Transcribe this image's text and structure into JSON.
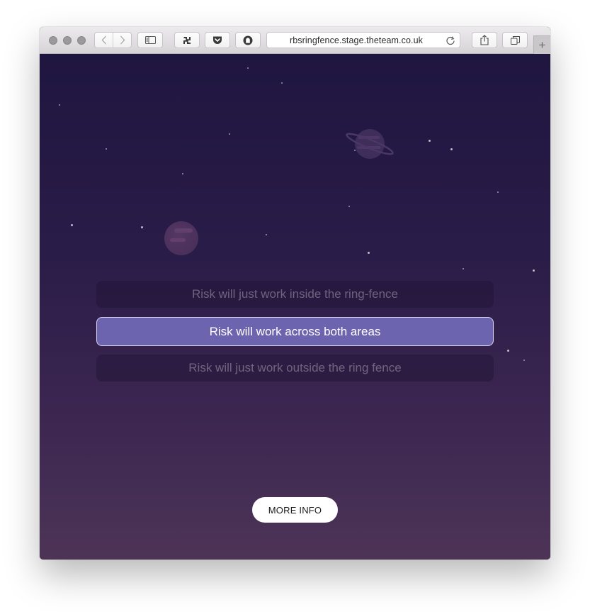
{
  "browser": {
    "url": "rbsringfence.stage.theteam.co.uk",
    "new_tab_symbol": "+"
  },
  "question": {
    "options": [
      {
        "label": "Risk will just work inside the ring-fence",
        "selected": false
      },
      {
        "label": "Risk will work across both areas",
        "selected": true
      },
      {
        "label": "Risk will just work outside the ring fence",
        "selected": false
      }
    ]
  },
  "more_info": {
    "label": "MORE INFO"
  },
  "colors": {
    "background_top": "#1f1640",
    "background_bottom": "#4d3457",
    "selected_option": "#6d64b0",
    "button": "#ffffff"
  },
  "icons": [
    "close-icon",
    "minimize-icon",
    "zoom-icon",
    "back-icon",
    "forward-icon",
    "sidebar-icon",
    "extension-icon",
    "pocket-icon",
    "ghostery-icon",
    "reload-icon",
    "share-icon",
    "tabs-icon",
    "new-tab-icon"
  ]
}
